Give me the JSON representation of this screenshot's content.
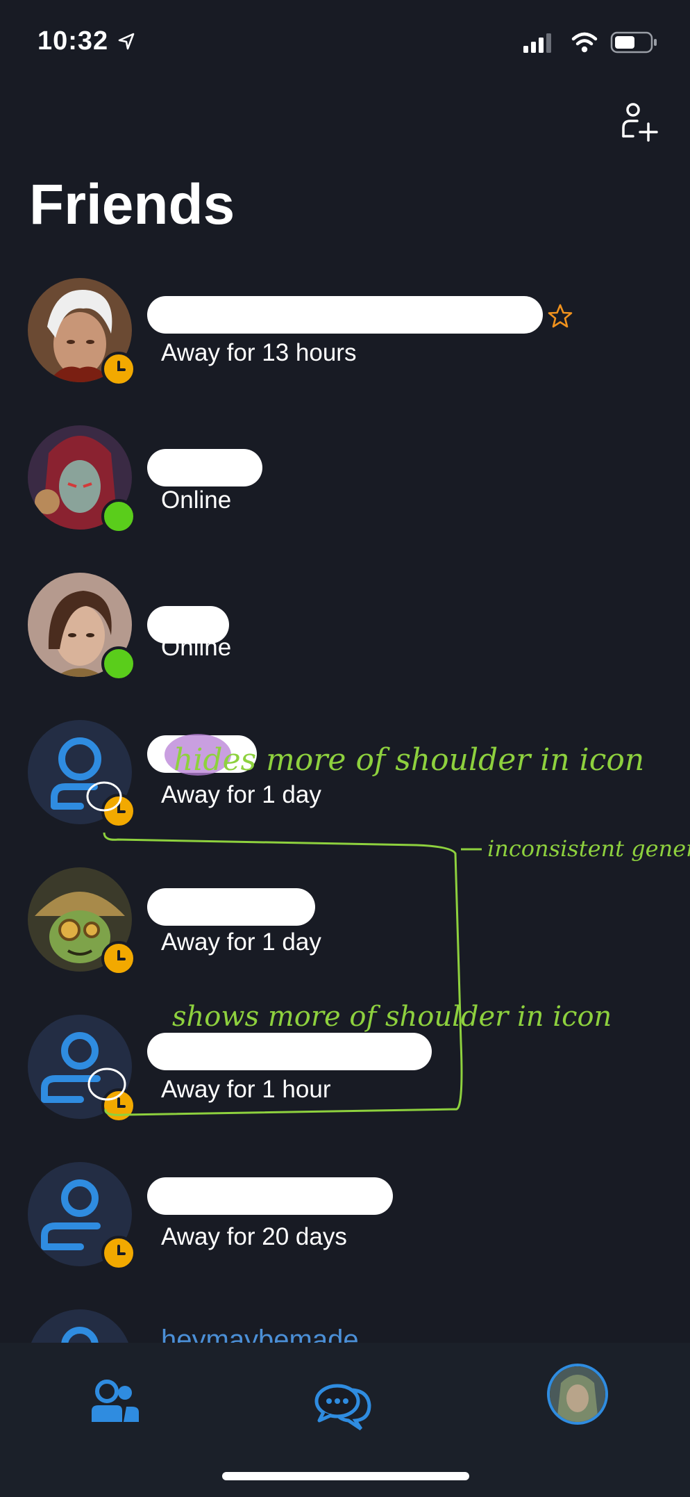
{
  "status_bar": {
    "time": "10:32",
    "wifi": "wifi-icon",
    "cellular": "cellular-icon",
    "battery": "battery-icon"
  },
  "header": {
    "title": "Friends",
    "add_friend_icon": "add-friend-icon"
  },
  "friends": [
    {
      "name": "",
      "status": "Away for 13 hours",
      "presence": "away",
      "favorite": true,
      "avatar": "hero-white-hair"
    },
    {
      "name": "",
      "status": "Online",
      "presence": "online",
      "favorite": false,
      "avatar": "hero-red-hood"
    },
    {
      "name": "",
      "status": "Online",
      "presence": "online",
      "favorite": false,
      "avatar": "hero-brown-hair"
    },
    {
      "name": "",
      "status": "Away for 1 day",
      "presence": "away",
      "favorite": false,
      "avatar": "default-user"
    },
    {
      "name": "",
      "status": "Away for 1 day",
      "presence": "away",
      "favorite": false,
      "avatar": "hero-goblin"
    },
    {
      "name": "",
      "status": "Away for 1 hour",
      "presence": "away",
      "favorite": false,
      "avatar": "default-user"
    },
    {
      "name": "",
      "status": "Away for 20 days",
      "presence": "away",
      "favorite": false,
      "avatar": "default-user"
    }
  ],
  "partial_row": {
    "name": "heymaybemade"
  },
  "annotations": {
    "note1": "hides more of shoulder in icon",
    "note2": "inconsistent general icons.",
    "note3": "shows more of shoulder in icon"
  },
  "tab_bar": {
    "tabs": [
      "friends-tab",
      "chat-tab",
      "profile-tab"
    ]
  },
  "colors": {
    "background": "#181b24",
    "accent": "#2f8ce0",
    "away": "#f2a900",
    "online": "#5acd1b",
    "annotation": "#8ed13e"
  }
}
